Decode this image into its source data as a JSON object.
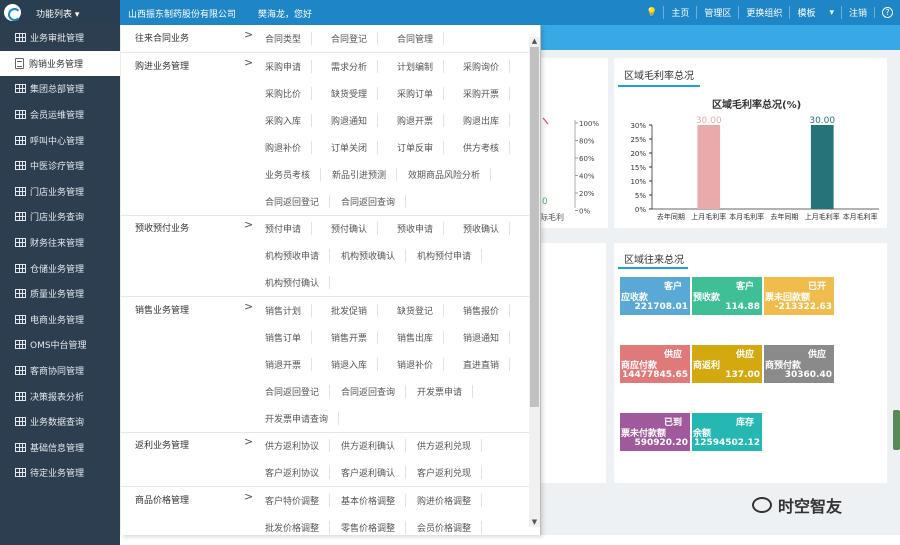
{
  "topbar": {
    "menu_toggle": "功能列表 ▾",
    "company": "山西振东制药股份有限公司",
    "greeting": "樊海龙，您好",
    "links": [
      "主页",
      "管理区",
      "更换组织",
      "模板",
      "注销"
    ],
    "bulb_icon": "bulb-icon",
    "help_icon": "help-icon",
    "caret": "▾",
    "help_glyph": "?"
  },
  "sidebar": {
    "items": [
      {
        "label": "业务审批管理"
      },
      {
        "label": "购销业务管理"
      },
      {
        "label": "集团总部管理"
      },
      {
        "label": "会员运维管理"
      },
      {
        "label": "呼叫中心管理"
      },
      {
        "label": "中医诊疗管理"
      },
      {
        "label": "门店业务管理"
      },
      {
        "label": "门店业务查询"
      },
      {
        "label": "财务往来管理"
      },
      {
        "label": "仓储业务管理"
      },
      {
        "label": "质量业务管理"
      },
      {
        "label": "电商业务管理"
      },
      {
        "label": "OMS中台管理"
      },
      {
        "label": "客商协同管理"
      },
      {
        "label": "决策报表分析"
      },
      {
        "label": "业务数据查询"
      },
      {
        "label": "基础信息管理"
      },
      {
        "label": "待定业务管理"
      }
    ],
    "active_index": 1
  },
  "menu": {
    "arrow": ">",
    "categories": [
      {
        "title": "往来合同业务",
        "rows": [
          [
            "合同类型",
            "合同登记",
            "合同管理"
          ]
        ]
      },
      {
        "title": "购进业务管理",
        "rows": [
          [
            "采购申请",
            "需求分析",
            "计划编制",
            "采购询价"
          ],
          [
            "采购比价",
            "缺货受理",
            "采购订单",
            "采购开票"
          ],
          [
            "采购入库",
            "购退通知",
            "购退开票",
            "购退出库"
          ],
          [
            "购退补价",
            "订单关闭",
            "订单反审",
            "供方考核"
          ],
          [
            "业务员考核",
            "新品引进预测",
            "效期商品风险分析"
          ],
          [
            "合同返回登记",
            "合同返回查询"
          ]
        ]
      },
      {
        "title": "预收预付业务",
        "rows": [
          [
            "预付申请",
            "预付确认",
            "预收申请",
            "预收确认"
          ],
          [
            "机构预收申请",
            "机构预收确认",
            "机构预付申请"
          ],
          [
            "机构预付确认"
          ]
        ]
      },
      {
        "title": "销售业务管理",
        "rows": [
          [
            "销售计划",
            "批发促销",
            "缺货登记",
            "销售报价"
          ],
          [
            "销售订单",
            "销售开票",
            "销售出库",
            "销退通知"
          ],
          [
            "销退开票",
            "销退入库",
            "销退补价",
            "直进直销"
          ],
          [
            "合同返回登记",
            "合同返回查询",
            "开发票申请"
          ],
          [
            "开发票申请查询"
          ]
        ]
      },
      {
        "title": "返利业务管理",
        "rows": [
          [
            "供方返利协议",
            "供方返利确认",
            "供方返利兑现"
          ],
          [
            "客户返利协议",
            "客户返利确认",
            "客户返利兑现"
          ]
        ]
      },
      {
        "title": "商品价格管理",
        "rows": [
          [
            "客户特价调整",
            "基本价格调整",
            "购进价格调整"
          ],
          [
            "批发价格调整",
            "零售价格调整",
            "会员价格调整"
          ]
        ]
      }
    ]
  },
  "dashboard": {
    "margin_panel": {
      "title": "区域毛利率总况"
    },
    "ar_panel": {
      "title": "区域往来总况"
    },
    "left_chart_fragment": {
      "axis_ticks": [
        "100%",
        "80%",
        "60%",
        "40%",
        "20%",
        "0%"
      ],
      "zero_label": "0",
      "xlabel_fragment": "际毛利"
    },
    "tiles": [
      {
        "l1": "客户",
        "l2": "应收款",
        "value": "221708.01",
        "color": "#59a8d6"
      },
      {
        "l1": "客户",
        "l2": "预收款",
        "value": "114.88",
        "color": "#3fbf96"
      },
      {
        "l1": "已开",
        "l2": "票未回款额",
        "value": "-213322.63",
        "color": "#f0bc4c"
      },
      {
        "l1": "供应",
        "l2": "商应付款",
        "value": "14477845.65",
        "color": "#e07a7a"
      },
      {
        "l1": "供应",
        "l2": "商返利",
        "value": "137.00",
        "color": "#d4a90f"
      },
      {
        "l1": "供应",
        "l2": "商预付款",
        "value": "30360.40",
        "color": "#8a8a8a"
      },
      {
        "l1": "已到",
        "l2": "票未付款额",
        "value": "590920.20",
        "color": "#a05a9c"
      },
      {
        "l1": "库存",
        "l2": "余额",
        "value": "12594502.12",
        "color": "#25b8b3"
      }
    ]
  },
  "chart_data": {
    "type": "bar",
    "title": "区域毛利率总况(%)",
    "categories": [
      "去年同期",
      "上月毛利率",
      "本月毛利率",
      "去年同期",
      "上月毛利率",
      "本月毛利率"
    ],
    "tick_labels": [
      "去年同期",
      "上月毛利率",
      "本月毛利率",
      "去年同期",
      "上月毛利率",
      "本月毛利率"
    ],
    "values": [
      0,
      30.0,
      0,
      0,
      30.0,
      0
    ],
    "data_labels": [
      "",
      "30.00",
      "",
      "",
      "30.00",
      ""
    ],
    "bar_colors": [
      "#e8aaaa",
      "#e8aaaa",
      "#e8aaaa",
      "#26737a",
      "#26737a",
      "#26737a"
    ],
    "y_ticks": [
      "30%",
      "25%",
      "20%",
      "15%",
      "10%",
      "5%",
      "0%"
    ],
    "ylim": [
      0,
      30
    ]
  },
  "watermark": {
    "text": "时空智友"
  }
}
